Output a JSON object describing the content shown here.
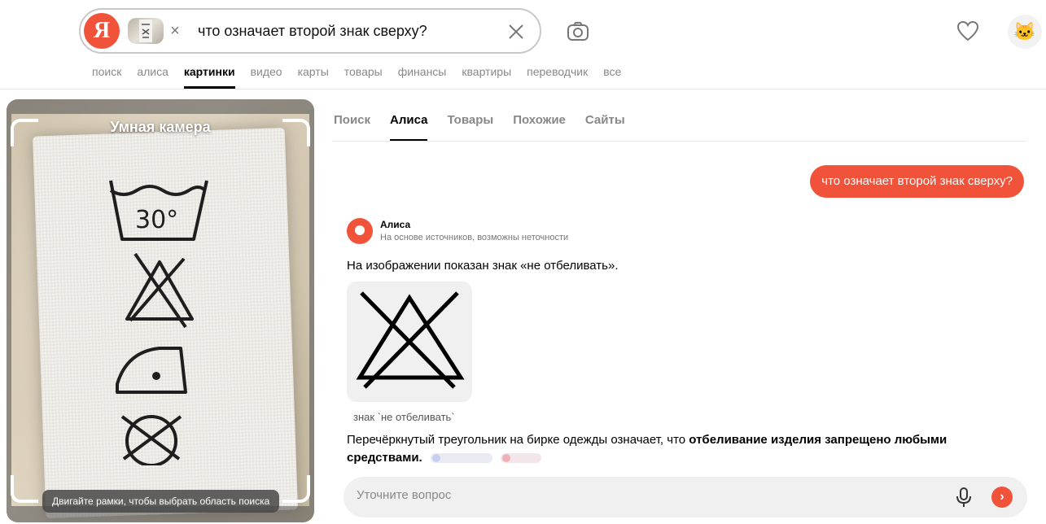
{
  "header": {
    "logo_letter": "Я",
    "query": "что означает второй знак сверху?",
    "icons": [
      "yandex-logo",
      "image-thumbnail",
      "close-icon",
      "clear-icon",
      "camera-icon",
      "heart-icon",
      "cat-avatar-icon"
    ],
    "avatar_glyph": "🐱"
  },
  "nav": {
    "items": [
      "поиск",
      "алиса",
      "картинки",
      "видео",
      "карты",
      "товары",
      "финансы",
      "квартиры",
      "переводчик",
      "все"
    ],
    "active": "картинки"
  },
  "camera_panel": {
    "title": "Умная камера",
    "hint": "Двигайте рамки, чтобы выбрать область поиска"
  },
  "tabs": {
    "items": [
      "Поиск",
      "Алиса",
      "Товары",
      "Похожие",
      "Сайты"
    ],
    "active": "Алиса"
  },
  "chat": {
    "user_message": "что означает второй знак сверху?",
    "assistant_name": "Алиса",
    "assistant_subtitle": "На основе источников, возможны неточности",
    "answer_intro": "На изображении показан знак «не отбеливать».",
    "image_caption": "знак `не отбеливать`",
    "answer_text_plain": "Перечёркнутый треугольник на бирке одежды означает, что ",
    "answer_text_bold": "отбеливание изделия запрещено любыми средствами.",
    "ask_placeholder": "Уточните вопрос"
  },
  "colors": {
    "accent": "#f0533a",
    "nav_inactive": "#888888",
    "ask_bg": "#f0f0f0"
  }
}
